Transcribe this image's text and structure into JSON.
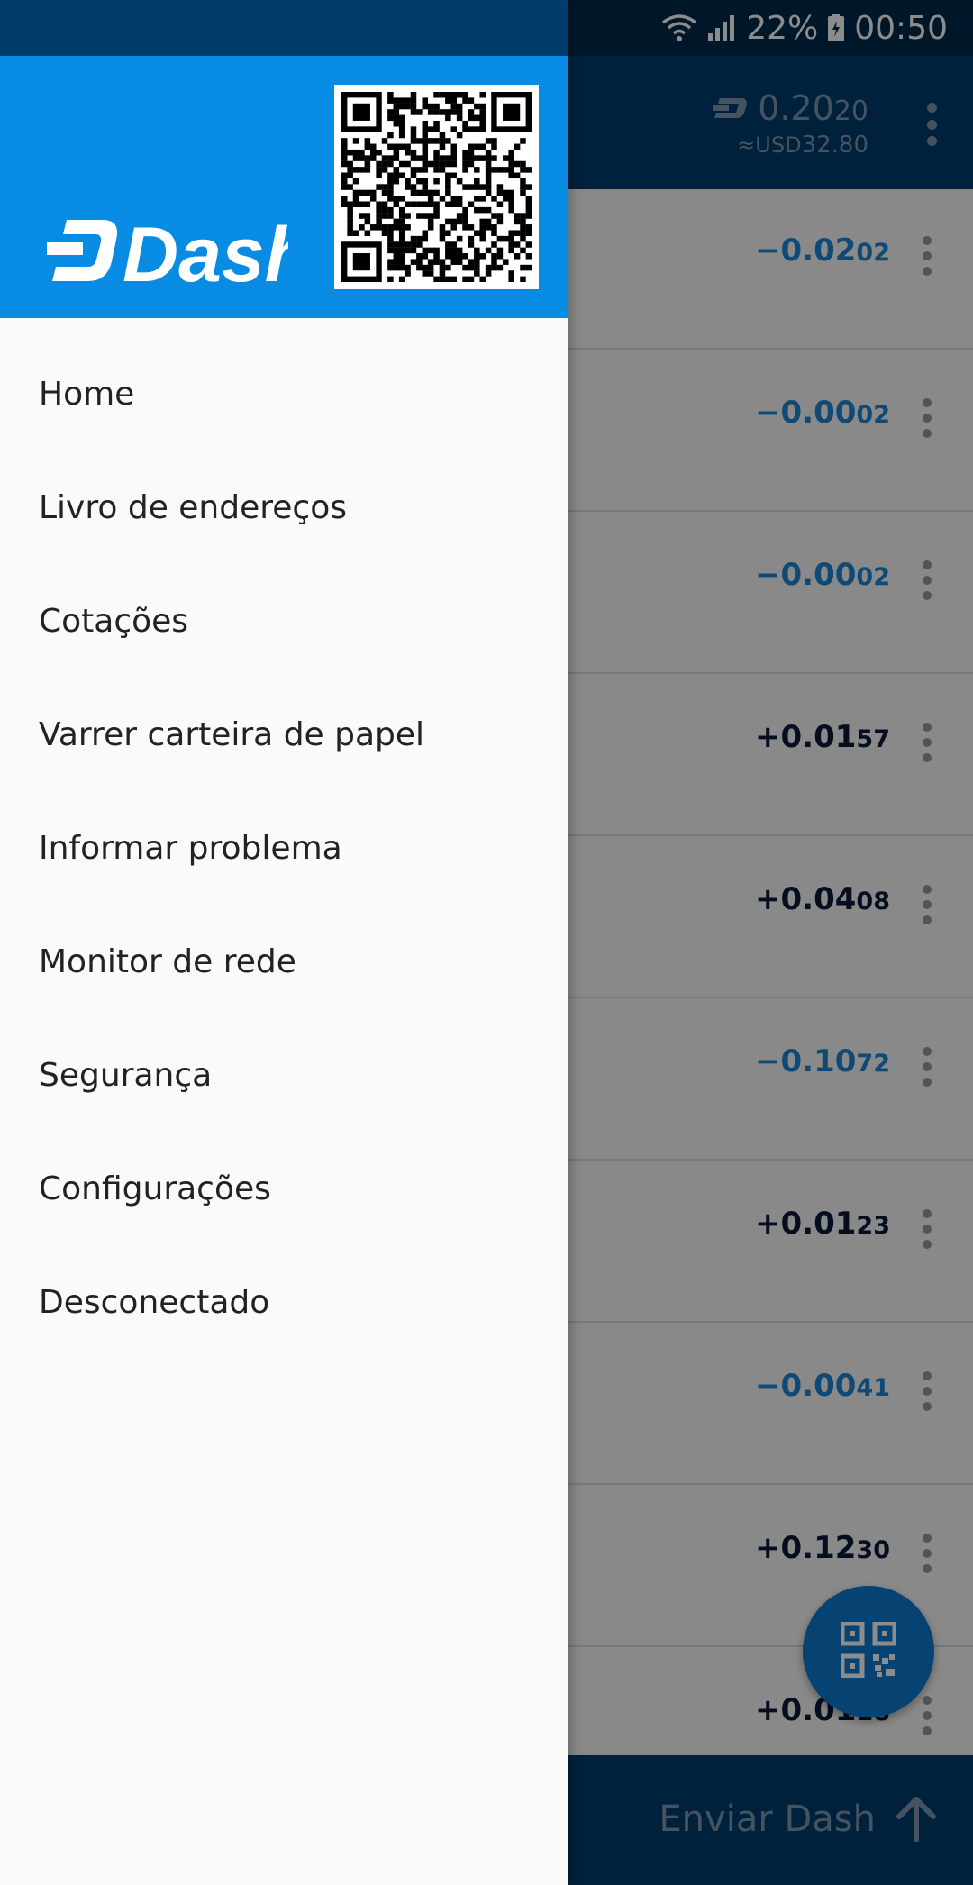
{
  "status_bar": {
    "battery": "22%",
    "time": "00:50"
  },
  "header": {
    "balance_main": "0.20",
    "balance_small": "20",
    "currency_prefix": "≈USD",
    "usd_value": "32.80"
  },
  "transactions": [
    {
      "main": "−0.02",
      "small": "02",
      "sign": "neg"
    },
    {
      "main": "−0.00",
      "small": "02",
      "sign": "neg"
    },
    {
      "main": "−0.00",
      "small": "02",
      "sign": "neg"
    },
    {
      "main": "+0.01",
      "small": "57",
      "sign": "pos"
    },
    {
      "main": "+0.04",
      "small": "08",
      "sign": "pos"
    },
    {
      "main": "−0.10",
      "small": "72",
      "sign": "neg"
    },
    {
      "main": "+0.01",
      "small": "23",
      "sign": "pos"
    },
    {
      "main": "−0.00",
      "small": "41",
      "sign": "neg"
    },
    {
      "main": "+0.12",
      "small": "30",
      "sign": "pos"
    },
    {
      "main": "+0.01",
      "small": "18",
      "sign": "pos"
    }
  ],
  "send_bar": {
    "label": "Enviar Dash"
  },
  "drawer": {
    "logo_text": "Dash",
    "menu": [
      "Home",
      "Livro de endereços",
      "Cotações",
      "Varrer carteira de papel",
      "Informar problema",
      "Monitor de rede",
      "Segurança",
      "Configurações",
      "Desconectado"
    ]
  },
  "colors": {
    "drawer_header": "#088be2",
    "app_bar": "#013d6c",
    "negative": "#1d86d6",
    "positive": "#0a1a3a"
  },
  "icons": [
    "wifi-icon",
    "signal-icon",
    "battery-icon",
    "dash-currency-icon",
    "more-vert-icon",
    "qr-code-icon",
    "scan-qr-icon",
    "arrow-up-icon"
  ]
}
